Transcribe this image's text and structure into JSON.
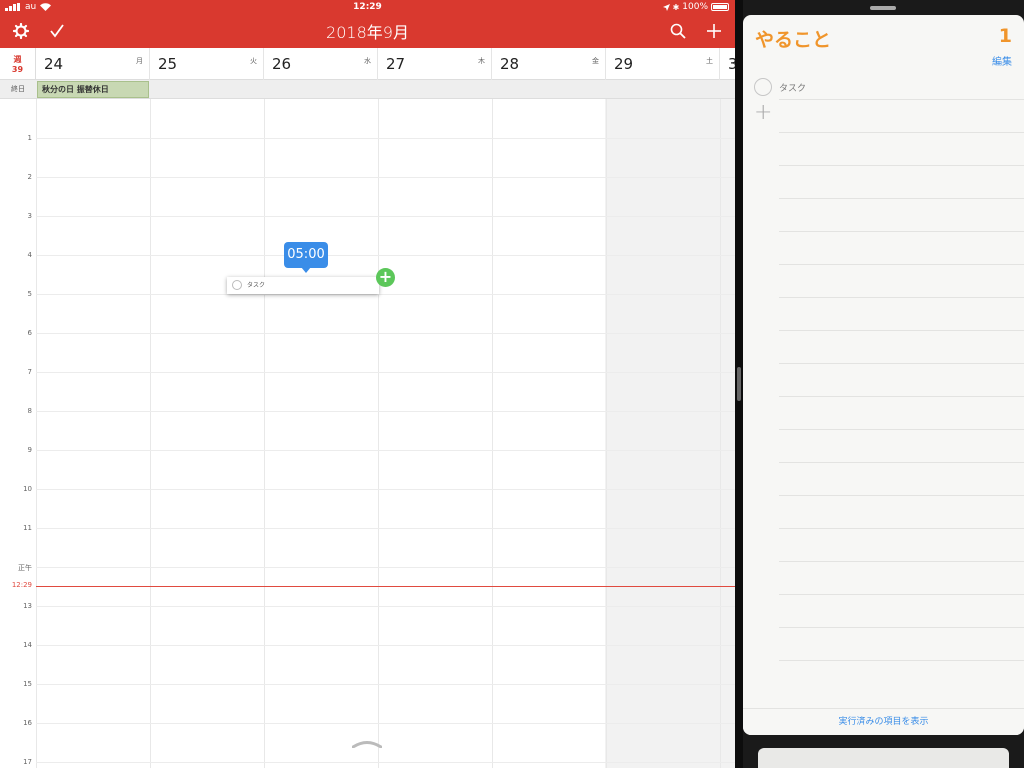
{
  "status": {
    "carrier": "au",
    "time": "12:29",
    "battery": "100%"
  },
  "header": {
    "title": "2018年9月",
    "settings_icon": "gear-icon",
    "check_icon": "checkmark-icon",
    "search_icon": "search-icon",
    "add_icon": "plus-icon"
  },
  "week": {
    "label_top": "週",
    "label_num": "39"
  },
  "days": [
    {
      "num": "24",
      "dow": "月"
    },
    {
      "num": "25",
      "dow": "火"
    },
    {
      "num": "26",
      "dow": "水"
    },
    {
      "num": "27",
      "dow": "木"
    },
    {
      "num": "28",
      "dow": "金"
    },
    {
      "num": "29",
      "dow": "土"
    },
    {
      "num": "3",
      "dow": ""
    }
  ],
  "allday": {
    "label": "終日",
    "event": "秋分の日 振替休日"
  },
  "hours": [
    "1",
    "2",
    "3",
    "4",
    "5",
    "6",
    "7",
    "8",
    "9",
    "10",
    "11",
    "正午",
    "13",
    "14",
    "15",
    "16",
    "17"
  ],
  "now": {
    "label": "12:29"
  },
  "drag": {
    "time": "05:00",
    "task": "タスク"
  },
  "reminders": {
    "title": "やること",
    "count": "1",
    "edit": "編集",
    "item": "タスク",
    "footer": "実行済みの項目を表示"
  },
  "colors": {
    "accent_red": "#d9392f",
    "reminders_orange": "#f0952b",
    "link_blue": "#3a8de8"
  }
}
